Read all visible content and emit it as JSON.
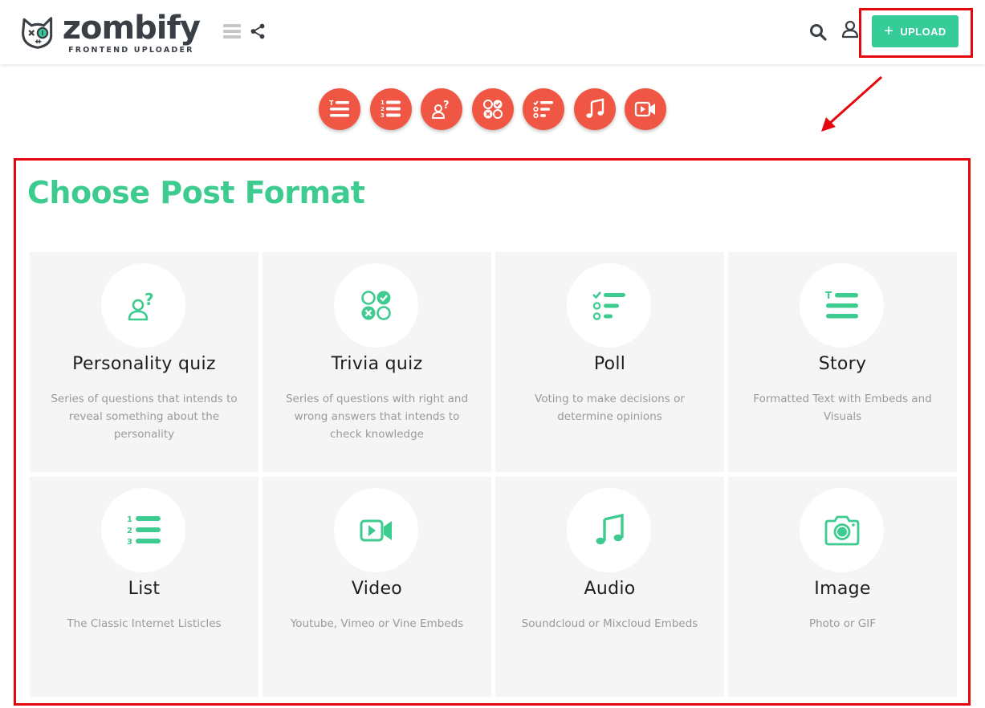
{
  "header": {
    "logo_word": "zombify",
    "logo_sub": "FRONTEND UPLOADER",
    "upload_label": "UPLOAD"
  },
  "page": {
    "title": "Choose Post Format"
  },
  "format_icons": [
    "story-icon",
    "list-icon",
    "personality-quiz-icon",
    "trivia-quiz-icon",
    "poll-icon",
    "audio-icon",
    "video-icon"
  ],
  "formats": [
    {
      "title": "Personality quiz",
      "desc": "Series of questions that intends to reveal something about the personality",
      "icon": "personality-quiz-icon"
    },
    {
      "title": "Trivia quiz",
      "desc": "Series of questions with right and wrong answers that intends to check knowledge",
      "icon": "trivia-quiz-icon"
    },
    {
      "title": "Poll",
      "desc": "Voting to make decisions or determine opinions",
      "icon": "poll-icon"
    },
    {
      "title": "Story",
      "desc": "Formatted Text with Embeds and Visuals",
      "icon": "story-icon"
    },
    {
      "title": "List",
      "desc": "The Classic Internet Listicles",
      "icon": "list-icon"
    },
    {
      "title": "Video",
      "desc": "Youtube, Vimeo or Vine Embeds",
      "icon": "video-icon"
    },
    {
      "title": "Audio",
      "desc": "Soundcloud or Mixcloud Embeds",
      "icon": "audio-icon"
    },
    {
      "title": "Image",
      "desc": "Photo or GIF",
      "icon": "camera-icon"
    }
  ],
  "colors": {
    "accent_green": "#36cc98",
    "title_green": "#3ecb8f",
    "circle_red": "#ef5744",
    "highlight_red": "#e5060e"
  }
}
